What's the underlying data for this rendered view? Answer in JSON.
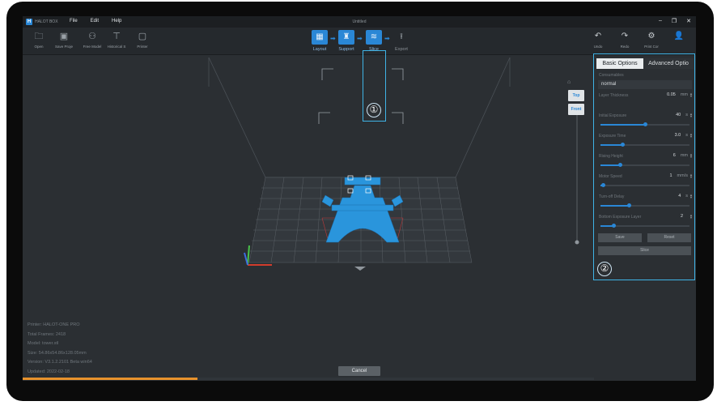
{
  "titlebar": {
    "brand": "HALOT BOX",
    "menu": [
      "File",
      "Edit",
      "Help"
    ],
    "doc_title": "Untitled"
  },
  "toolbar": {
    "left_tools": [
      {
        "label": "Open",
        "icon": "folder-icon"
      },
      {
        "label": "Save Proje",
        "icon": "save-icon"
      },
      {
        "label": "Free Model",
        "icon": "cloud-models-icon"
      },
      {
        "label": "Historical S",
        "icon": "history-icon"
      },
      {
        "label": "Printer",
        "icon": "printer-icon"
      }
    ],
    "workflow": [
      {
        "label": "Layout",
        "icon": "layout-icon"
      },
      {
        "label": "Support",
        "icon": "support-icon"
      },
      {
        "label": "Slice",
        "icon": "slice-icon"
      },
      {
        "label": "Export",
        "icon": "export-icon"
      }
    ],
    "right_tools": [
      {
        "label": "Undo",
        "icon": "undo-icon"
      },
      {
        "label": "Redo",
        "icon": "redo-icon"
      },
      {
        "label": "Print Cor",
        "icon": "print-center-icon"
      },
      {
        "label": "",
        "icon": "user-icon"
      }
    ]
  },
  "callouts": {
    "one": "①",
    "two": "②"
  },
  "view_buttons": {
    "top": "Top",
    "front": "Front"
  },
  "info": {
    "printer": "Printer: HALOT-ONE PRO",
    "frames": "Total Frames: 2418",
    "model": "Model: tower.stl",
    "size": "Size: 54.86x54.86x128.05mm",
    "version": "Version: V3.1.2.2101 Beta win64",
    "updated": "Updated: 2022-02-18"
  },
  "cancel_label": "Cancel",
  "progress_fraction": 0.26,
  "panel": {
    "tab_basic": "Basic Options",
    "tab_advanced": "Advanced Optio",
    "consumables_label": "Consumables",
    "consumables_value": "normal",
    "params": [
      {
        "label": "Layer Thickness",
        "value": "0.05",
        "unit": "mm",
        "slider": null
      },
      {
        "label": "Initial Exposure",
        "value": "40",
        "unit": "s",
        "slider": 0.5
      },
      {
        "label": "Exposure Time",
        "value": "3.0",
        "unit": "s",
        "slider": 0.25
      },
      {
        "label": "Rising Height",
        "value": "6",
        "unit": "mm",
        "slider": 0.22
      },
      {
        "label": "Motor Speed",
        "value": "1",
        "unit": "mm/s",
        "slider": 0.03
      },
      {
        "label": "Turn-off Delay",
        "value": "4",
        "unit": "s",
        "slider": 0.32
      },
      {
        "label": "Bottom Exposure Layer",
        "value": "2",
        "unit": "",
        "slider": 0.15
      }
    ],
    "save_label": "Save",
    "reset_label": "Reset",
    "slice_label": "Slice"
  }
}
